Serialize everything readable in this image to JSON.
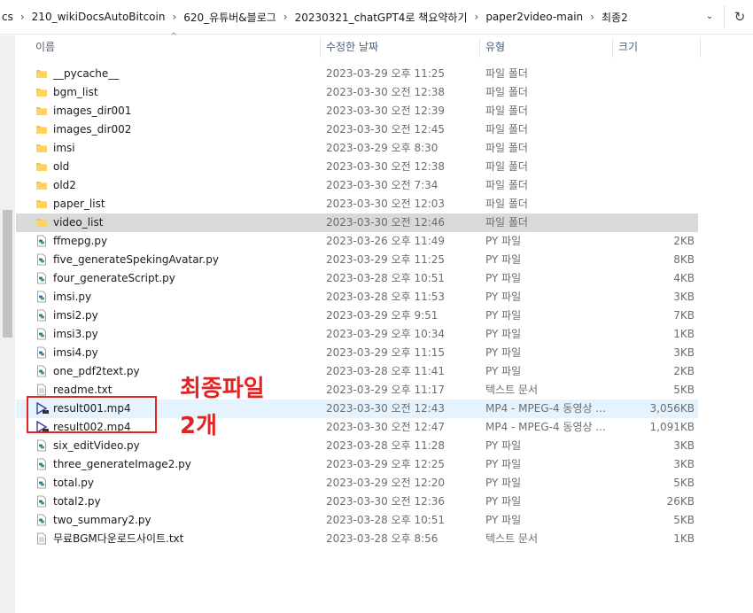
{
  "breadcrumbs": [
    "cs",
    "210_wikiDocsAutoBitcoin",
    "620_유튜버&블로그",
    "20230321_chatGPT4로 책요약하기",
    "paper2video-main",
    "최종2"
  ],
  "columns": {
    "name": "이름",
    "date": "수정한 날짜",
    "type": "유형",
    "size": "크기"
  },
  "files": [
    {
      "name": "__pycache__",
      "date": "2023-03-29 오후 11:25",
      "type": "파일 폴더",
      "size": "",
      "icon": "folder-icon"
    },
    {
      "name": "bgm_list",
      "date": "2023-03-30 오전 12:38",
      "type": "파일 폴더",
      "size": "",
      "icon": "folder-icon"
    },
    {
      "name": "images_dir001",
      "date": "2023-03-30 오전 12:39",
      "type": "파일 폴더",
      "size": "",
      "icon": "folder-icon"
    },
    {
      "name": "images_dir002",
      "date": "2023-03-30 오전 12:45",
      "type": "파일 폴더",
      "size": "",
      "icon": "folder-icon"
    },
    {
      "name": "imsi",
      "date": "2023-03-29 오후 8:30",
      "type": "파일 폴더",
      "size": "",
      "icon": "folder-icon"
    },
    {
      "name": "old",
      "date": "2023-03-30 오전 12:38",
      "type": "파일 폴더",
      "size": "",
      "icon": "folder-icon"
    },
    {
      "name": "old2",
      "date": "2023-03-30 오전 7:34",
      "type": "파일 폴더",
      "size": "",
      "icon": "folder-icon"
    },
    {
      "name": "paper_list",
      "date": "2023-03-30 오전 12:03",
      "type": "파일 폴더",
      "size": "",
      "icon": "folder-icon"
    },
    {
      "name": "video_list",
      "date": "2023-03-30 오전 12:46",
      "type": "파일 폴더",
      "size": "",
      "icon": "folder-icon"
    },
    {
      "name": "ffmepg.py",
      "date": "2023-03-26 오후 11:49",
      "type": "PY 파일",
      "size": "2KB",
      "icon": "python-file-icon"
    },
    {
      "name": "five_generateSpekingAvatar.py",
      "date": "2023-03-29 오후 11:25",
      "type": "PY 파일",
      "size": "8KB",
      "icon": "python-file-icon"
    },
    {
      "name": "four_generateScript.py",
      "date": "2023-03-28 오후 10:51",
      "type": "PY 파일",
      "size": "4KB",
      "icon": "python-file-icon"
    },
    {
      "name": "imsi.py",
      "date": "2023-03-28 오후 11:53",
      "type": "PY 파일",
      "size": "3KB",
      "icon": "python-file-icon"
    },
    {
      "name": "imsi2.py",
      "date": "2023-03-29 오후 9:51",
      "type": "PY 파일",
      "size": "7KB",
      "icon": "python-file-icon"
    },
    {
      "name": "imsi3.py",
      "date": "2023-03-29 오후 10:34",
      "type": "PY 파일",
      "size": "1KB",
      "icon": "python-file-icon"
    },
    {
      "name": "imsi4.py",
      "date": "2023-03-29 오후 11:15",
      "type": "PY 파일",
      "size": "3KB",
      "icon": "python-file-icon"
    },
    {
      "name": "one_pdf2text.py",
      "date": "2023-03-28 오후 11:41",
      "type": "PY 파일",
      "size": "2KB",
      "icon": "python-file-icon"
    },
    {
      "name": "readme.txt",
      "date": "2023-03-29 오후 11:17",
      "type": "텍스트 문서",
      "size": "5KB",
      "icon": "text-file-icon"
    },
    {
      "name": "result001.mp4",
      "date": "2023-03-30 오전 12:43",
      "type": "MP4 - MPEG-4 동영상 ...",
      "size": "3,056KB",
      "icon": "video-file-icon"
    },
    {
      "name": "result002.mp4",
      "date": "2023-03-30 오전 12:47",
      "type": "MP4 - MPEG-4 동영상 ...",
      "size": "1,091KB",
      "icon": "video-file-icon"
    },
    {
      "name": "six_editVideo.py",
      "date": "2023-03-28 오후 11:28",
      "type": "PY 파일",
      "size": "3KB",
      "icon": "python-file-icon"
    },
    {
      "name": "three_generateImage2.py",
      "date": "2023-03-29 오후 12:25",
      "type": "PY 파일",
      "size": "3KB",
      "icon": "python-file-icon"
    },
    {
      "name": "total.py",
      "date": "2023-03-29 오전 12:20",
      "type": "PY 파일",
      "size": "5KB",
      "icon": "python-file-icon"
    },
    {
      "name": "total2.py",
      "date": "2023-03-30 오전 12:36",
      "type": "PY 파일",
      "size": "26KB",
      "icon": "python-file-icon"
    },
    {
      "name": "two_summary2.py",
      "date": "2023-03-28 오후 10:51",
      "type": "PY 파일",
      "size": "5KB",
      "icon": "python-file-icon"
    },
    {
      "name": "무료BGM다운로드사이트.txt",
      "date": "2023-03-28 오후 8:56",
      "type": "텍스트 문서",
      "size": "1KB",
      "icon": "text-file-icon"
    }
  ],
  "selected_index": 8,
  "hovered_index": 18,
  "annotation": {
    "line1": "최종파일",
    "line2": "2개",
    "color": "#e02424"
  },
  "colors": {
    "folder": "#f5c342",
    "selection": "#d9d9d9",
    "hover": "#e5f3ff",
    "header_text": "#4c607a"
  }
}
